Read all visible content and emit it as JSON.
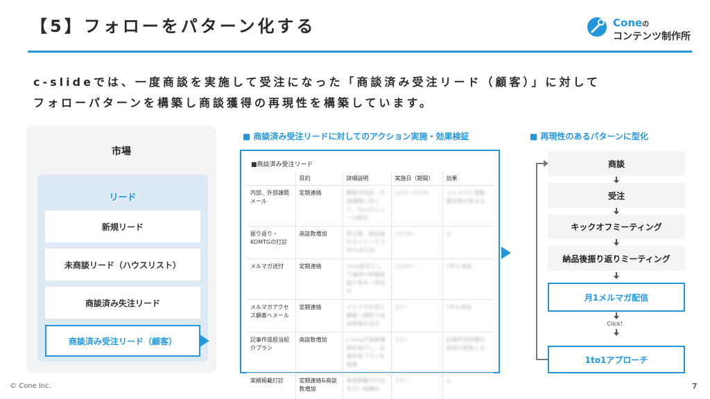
{
  "header": {
    "title": "【5】フォローをパターン化する",
    "logo": {
      "brand": "Cone",
      "brand_suffix": "の",
      "subtitle": "コンテンツ制作所"
    }
  },
  "intro": {
    "line1": "c-slideでは、一度商談を実施して受注になった「商談済み受注リード（顧客）」に対して",
    "line2": "フォローパターンを構築し商談獲得の再現性を構築しています。"
  },
  "market": {
    "title": "市場",
    "lead_title": "リード",
    "items": [
      "新規リード",
      "未商談リード（ハウスリスト）",
      "商談済み失注リード",
      "商談済み受注リード（顧客）"
    ]
  },
  "action": {
    "heading": "■ 商談済み受注リードに対してのアクション実施・効果検証",
    "table_caption": "■商談済み受注リード",
    "columns": [
      "",
      "目的",
      "詳細説明",
      "実施日（期間）",
      "効果"
    ],
    "rows": [
      [
        "内部、外部課題メール",
        "定期連絡",
        "顧客の内部、外部課題に応じて、Tipsやニュース配信",
        "12/2〜12/31",
        "メルマガと連動開封率が高まる"
      ],
      [
        "振り返り・KOMTGの打診",
        "商談数増加",
        "受注後、納品後のタイミングでMTGを打診",
        "12/18〜",
        "◎"
      ],
      [
        "メルマガ送付",
        "定期連絡",
        "cone配信として事例や新機能紹介等を一斉送付",
        "12/26〜",
        "1件も商談"
      ],
      [
        "メルマガアクセス顧客へメール",
        "定期連絡",
        "メルマガを見た顧客へ個別で追加情報を送付",
        "1/2〜",
        "1件も商談"
      ],
      [
        "記事作成担当紹介プラン",
        "商談数増加",
        "c-blogの実績事例を紹介し、記事作成プランを提案",
        "1/2〜",
        "記事作成依頼の相談が複数入る"
      ],
      [
        "実績掲載打診",
        "定期連絡&商談数増加",
        "事例掲載の打診を行い実績化",
        "1/2〜",
        "◎"
      ]
    ]
  },
  "pattern": {
    "heading": "■ 再現性のあるパターンに型化",
    "steps": [
      "商談",
      "受注",
      "キックオフミーティング",
      "納品後振り返りミーティング",
      "月1メルマガ配信",
      "1to1アプローチ"
    ],
    "click_label": "Click！"
  },
  "footer": {
    "copyright": "© Cone Inc.",
    "page": "7"
  },
  "colors": {
    "accent": "#2596d8",
    "panel": "#f3f4f6",
    "lead_panel": "#dde9f5"
  }
}
